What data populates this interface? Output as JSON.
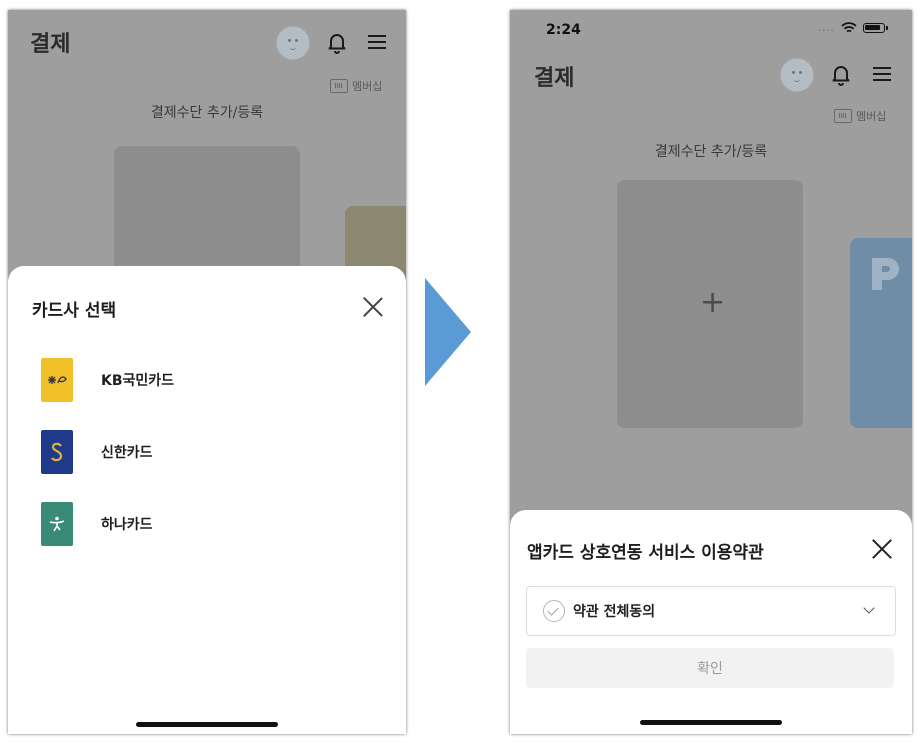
{
  "colors": {
    "dim_overlay": "#9e9e9e",
    "arrow": "#5b9bd5",
    "kb_brand": "#f2c028",
    "shinhan_brand": "#1f3a8a",
    "hana_brand": "#3a8a78",
    "partner_card_left": "#8c8770",
    "partner_card_right": "#6f8da6"
  },
  "left_screen": {
    "header": {
      "title": "결제",
      "avatar_icon": "avatar-icon",
      "bell_icon": "bell-icon",
      "menu_icon": "hamburger-icon"
    },
    "membership": {
      "label": "멤버십",
      "icon": "barcode-icon"
    },
    "section_title": "결제수단 추가/등록",
    "sheet": {
      "title": "카드사 선택",
      "close_icon": "close-icon",
      "card_companies": [
        {
          "name": "KB국민카드",
          "logo": "kb-logo"
        },
        {
          "name": "신한카드",
          "logo": "shinhan-logo"
        },
        {
          "name": "하나카드",
          "logo": "hana-logo"
        }
      ]
    }
  },
  "right_screen": {
    "status_bar": {
      "time": "2:24",
      "signal": "....",
      "wifi_icon": "wifi-icon",
      "battery_icon": "battery-icon"
    },
    "header": {
      "title": "결제",
      "avatar_icon": "avatar-icon",
      "bell_icon": "bell-icon",
      "menu_icon": "hamburger-icon"
    },
    "membership": {
      "label": "멤버십",
      "icon": "barcode-icon"
    },
    "section_title": "결제수단 추가/등록",
    "add_card": {
      "symbol": "+"
    },
    "sheet": {
      "title": "앱카드 상호연동 서비스 이용약관",
      "close_icon": "close-icon",
      "agree_all": {
        "label": "약관 전체동의",
        "expand_icon": "chevron-down-icon"
      },
      "confirm_label": "확인"
    }
  }
}
